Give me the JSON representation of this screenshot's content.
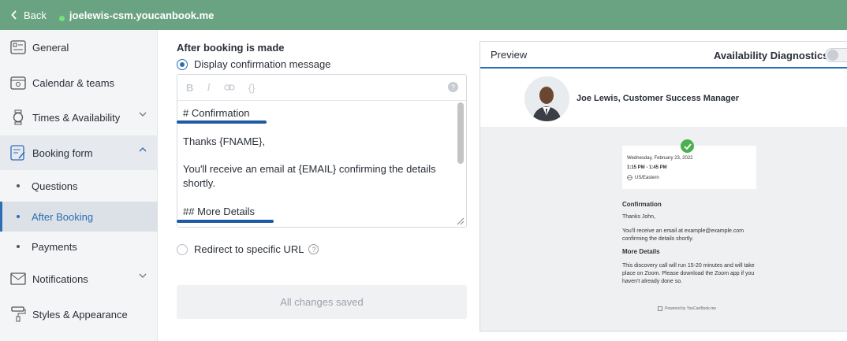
{
  "topbar": {
    "back_label": "Back",
    "site": "joelewis-csm.youcanbook.me",
    "color": "#6aa382"
  },
  "sidebar": {
    "general": "General",
    "calendar": "Calendar & teams",
    "times": "Times & Availability",
    "booking_form": "Booking form",
    "questions": "Questions",
    "after_booking": "After Booking",
    "payments": "Payments",
    "notifications": "Notifications",
    "styles": "Styles & Appearance"
  },
  "editor": {
    "section_title": "After booking is made",
    "option_message": "Display confirmation message",
    "option_redirect": "Redirect to specific URL",
    "toolbar": {
      "bold": "B",
      "italic": "I",
      "link": "⊝",
      "code": "{}",
      "help": "?"
    },
    "lines": {
      "l1": "# Confirmation",
      "l2": "Thanks {FNAME},",
      "l3": "You'll receive an email at {EMAIL} confirming the details shortly.",
      "l4": "## More Details"
    },
    "save_label": "All changes saved"
  },
  "preview": {
    "tab_label": "Preview",
    "diagnostics_label": "Availability Diagnostics",
    "diagnostics_on": false,
    "profile_name": "Joe Lewis, Customer Success Manager",
    "date": "Wednesday, February 23, 2022",
    "time": "1:15 PM - 1:45 PM",
    "timezone": "US/Eastern",
    "confirmation_heading": "Confirmation",
    "thanks": "Thanks John,",
    "email_line": "You'll receive an email at example@example.com confirming the details shortly.",
    "details_heading": "More Details",
    "details_text": "This discovery call will run 15-20 minutes and will take place on Zoom. Please download the Zoom app if you haven't already done so.",
    "powered": "Powered by YouCanBook.me"
  }
}
